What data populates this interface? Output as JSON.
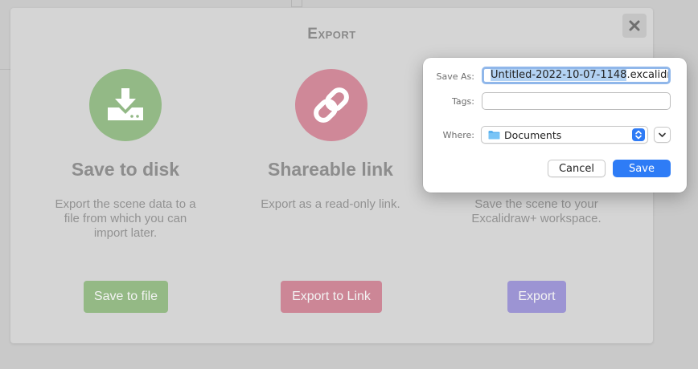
{
  "modal": {
    "title": "Export",
    "close_icon": "close-icon"
  },
  "cards": [
    {
      "icon": "download-icon",
      "icon_color": "#93b986",
      "heading": "Save to disk",
      "desc_lines": [
        "Export the scene data to a",
        "file from which you can",
        "import later."
      ],
      "button": "Save to file",
      "button_color": "#94b985"
    },
    {
      "icon": "link-icon",
      "icon_color": "#cf8898",
      "heading": "Shareable link",
      "desc_lines": [
        "Export as a read-only link."
      ],
      "button": "Export to Link",
      "button_color": "#cc8696"
    },
    {
      "desc_lines": [
        "Save the scene to your",
        "Excalidraw+ workspace."
      ],
      "button": "Export",
      "button_color": "#9c94d3"
    }
  ],
  "dialog": {
    "save_as_label": "Save As:",
    "save_as_selected": "Untitled-2022-10-07-1148",
    "save_as_rest": ".excalidraw",
    "tags_label": "Tags:",
    "tags_value": "",
    "where_label": "Where:",
    "where_value": "Documents",
    "where_icon": "folder-icon",
    "expand_icon": "chevron-down-icon",
    "cancel_label": "Cancel",
    "save_label": "Save",
    "accent": "#2e7cf6"
  }
}
